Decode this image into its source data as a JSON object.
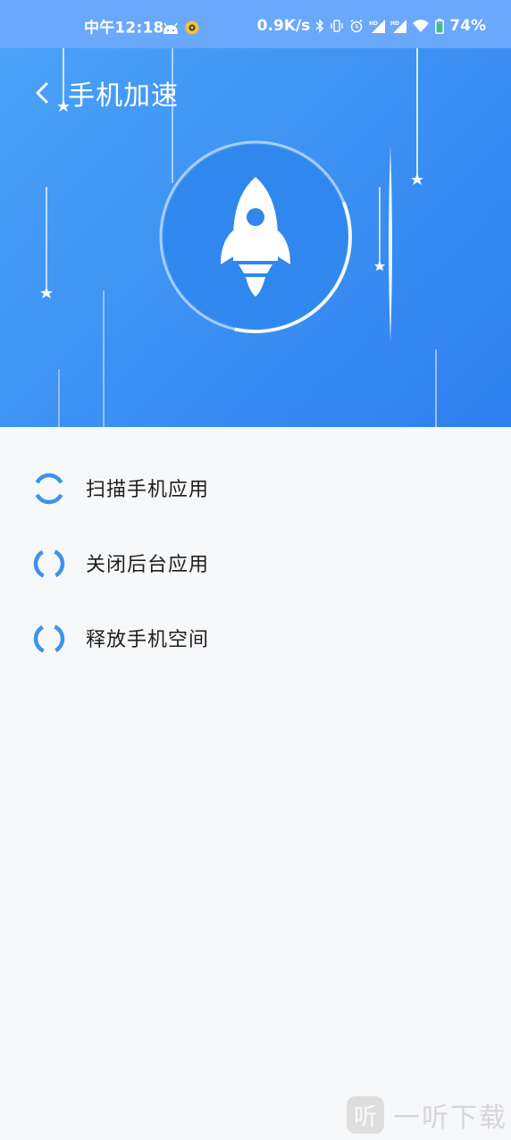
{
  "status_bar": {
    "time": "中午12:18",
    "network_speed": "0.9K/s",
    "battery": "74%",
    "icons": [
      "android-icon",
      "notification-icon",
      "bluetooth-icon",
      "vibrate-icon",
      "alarm-icon",
      "hd-signal-icon",
      "hd-signal-icon",
      "wifi-icon",
      "battery-icon"
    ]
  },
  "header": {
    "back_icon": "chevron-left-icon",
    "title": "手机加速"
  },
  "hero": {
    "icon": "rocket-icon",
    "background_from": "#4aa2f8",
    "background_to": "#2e7ff0",
    "disc_color": "#3087ee"
  },
  "tasks": [
    {
      "label": "扫描手机应用",
      "icon": "loading-spinner-icon"
    },
    {
      "label": "关闭后台应用",
      "icon": "loading-spinner-icon"
    },
    {
      "label": "释放手机空间",
      "icon": "loading-spinner-icon"
    }
  ],
  "accent_color": "#3d93ea",
  "watermark": {
    "badge": "听",
    "text": "一听下载"
  }
}
